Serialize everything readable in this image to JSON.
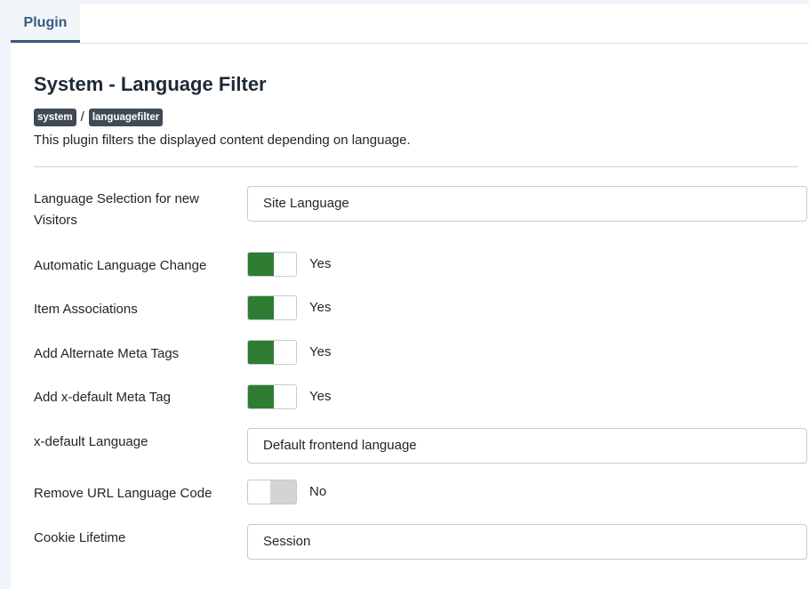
{
  "tabs": [
    {
      "label": "Plugin"
    }
  ],
  "header": {
    "title": "System - Language Filter",
    "tags": [
      "system",
      "languagefilter"
    ],
    "separator": "/",
    "description": "This plugin filters the displayed content depending on language."
  },
  "fields": {
    "language_selection": {
      "label": "Language Selection for new Visitors",
      "value": "Site Language"
    },
    "automatic_language_change": {
      "label": "Automatic Language Change",
      "state": "Yes",
      "on": true
    },
    "item_associations": {
      "label": "Item Associations",
      "state": "Yes",
      "on": true
    },
    "alternate_meta_tags": {
      "label": "Add Alternate Meta Tags",
      "state": "Yes",
      "on": true
    },
    "xdefault_meta_tag": {
      "label": "Add x-default Meta Tag",
      "state": "Yes",
      "on": true
    },
    "xdefault_language": {
      "label": "x-default Language",
      "value": "Default frontend language"
    },
    "remove_url_language_code": {
      "label": "Remove URL Language Code",
      "state": "No",
      "on": false
    },
    "cookie_lifetime": {
      "label": "Cookie Lifetime",
      "value": "Session"
    }
  },
  "colors": {
    "switch_on": "#2e7d32",
    "switch_off": "#d4d4d4",
    "tab_accent": "#3a5a85",
    "tag_bg": "#3f4a55"
  }
}
